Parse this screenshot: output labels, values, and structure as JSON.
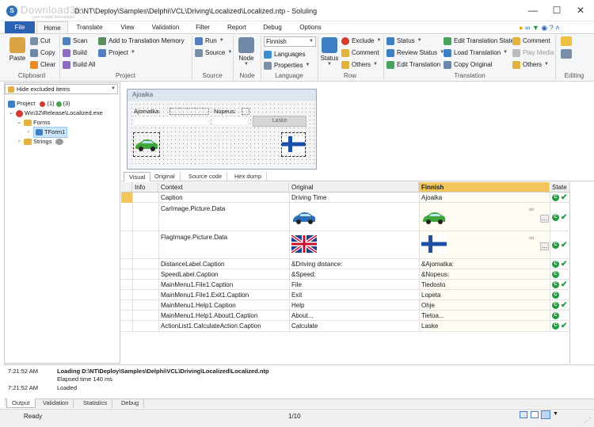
{
  "titlebar": {
    "watermark": "Download3k",
    "watermark_sub": "your trusted downloader",
    "title": "D:\\NT\\Deploy\\Samples\\Delphi\\VCL\\Driving\\Localized\\Localized.ntp - Soluling",
    "minimize": "—",
    "maximize": "☐",
    "close": "✕"
  },
  "menu_tabs": [
    "File",
    "Home",
    "Translate",
    "View",
    "Validation",
    "Filter",
    "Report",
    "Debug",
    "Options"
  ],
  "ribbon": {
    "clipboard": {
      "paste": "Paste",
      "cut": "Cut",
      "copy": "Copy",
      "clear": "Clear",
      "label": "Clipboard"
    },
    "project": {
      "scan": "Scan",
      "build": "Build",
      "build_all": "Build All",
      "add_tm": "Add to Translation Memory",
      "project": "Project",
      "label": "Project"
    },
    "source": {
      "run": "Run",
      "source": "Source",
      "label": "Source"
    },
    "node": {
      "node": "Node",
      "label": "Node"
    },
    "language": {
      "selected": "Finnish",
      "languages": "Languages",
      "properties": "Properties",
      "label": "Language"
    },
    "row": {
      "status": "Status",
      "exclude": "Exclude",
      "comment": "Comment",
      "others": "Others",
      "label": "Row"
    },
    "translation": {
      "status": "Status",
      "review_status": "Review Status",
      "edit_translation": "Edit Translation",
      "edit_translation_state": "Edit Translation State",
      "load_translation": "Load Translation",
      "copy_original": "Copy Original",
      "comment": "Comment",
      "play_media": "Play Media",
      "others": "Others",
      "label": "Translation"
    },
    "editing": {
      "label": "Editing"
    }
  },
  "left_pane": {
    "filter": "Hide excluded items",
    "tree": {
      "project": "Project",
      "project_counts": "(1)",
      "project_counts2": "(3)",
      "exe": "Win32\\Release\\Localized.exe",
      "forms": "Forms",
      "tform": "TForm1",
      "strings": "Strings"
    }
  },
  "preview": {
    "form_title": "Ajoaika",
    "label_distance": "Ajomatka:",
    "label_speed": "Nopeus:",
    "button": "Laske"
  },
  "view_tabs": [
    "Visual",
    "Original",
    "Source code",
    "Hex dump"
  ],
  "grid": {
    "headers": {
      "info": "Info",
      "context": "Context",
      "original": "Original",
      "finnish": "Finnish",
      "state": "State"
    },
    "rows": [
      {
        "context": "Caption",
        "original": "Driving Time",
        "finnish": "Ajoaika"
      },
      {
        "context": "CarImage.Picture.Data",
        "original": "",
        "finnish": ""
      },
      {
        "context": "FlagImage.Picture.Data",
        "original": "",
        "finnish": ""
      },
      {
        "context": "DistanceLabel.Caption",
        "original": "&Driving distance:",
        "finnish": "&Ajomatka:"
      },
      {
        "context": "SpeedLabel.Caption",
        "original": "&Speed:",
        "finnish": "&Nopeus:"
      },
      {
        "context": "MainMenu1.File1.Caption",
        "original": "File",
        "finnish": "Tiedosto"
      },
      {
        "context": "MainMenu1.File1.Exit1.Caption",
        "original": "Exit",
        "finnish": "Lopeta"
      },
      {
        "context": "MainMenu1.Help1.Caption",
        "original": "Help",
        "finnish": "Ohje"
      },
      {
        "context": "MainMenu1.Help1.About1.Caption",
        "original": "About...",
        "finnish": "Tietoa..."
      },
      {
        "context": "ActionList1.CalculateAction.Caption",
        "original": "Calculate",
        "finnish": "Laske"
      }
    ],
    "state_letter": "C"
  },
  "output": {
    "lines": [
      {
        "time": "7:21:52 AM",
        "text": "Loading D:\\NT\\Deploy\\Samples\\Delphi\\VCL\\Driving\\Localized\\Localized.ntp"
      },
      {
        "time": "",
        "text": "Elapsed time 140 ms"
      },
      {
        "time": "7:21:52 AM",
        "text": "Loaded"
      }
    ],
    "tabs": [
      "Output",
      "Validation",
      "Statistics",
      "Debug"
    ]
  },
  "statusbar": {
    "status": "Ready",
    "position": "1/10"
  },
  "colors": {
    "accent": "#2b63b4",
    "language_column": "#f3c65d",
    "state_green": "#1f9a3d"
  }
}
